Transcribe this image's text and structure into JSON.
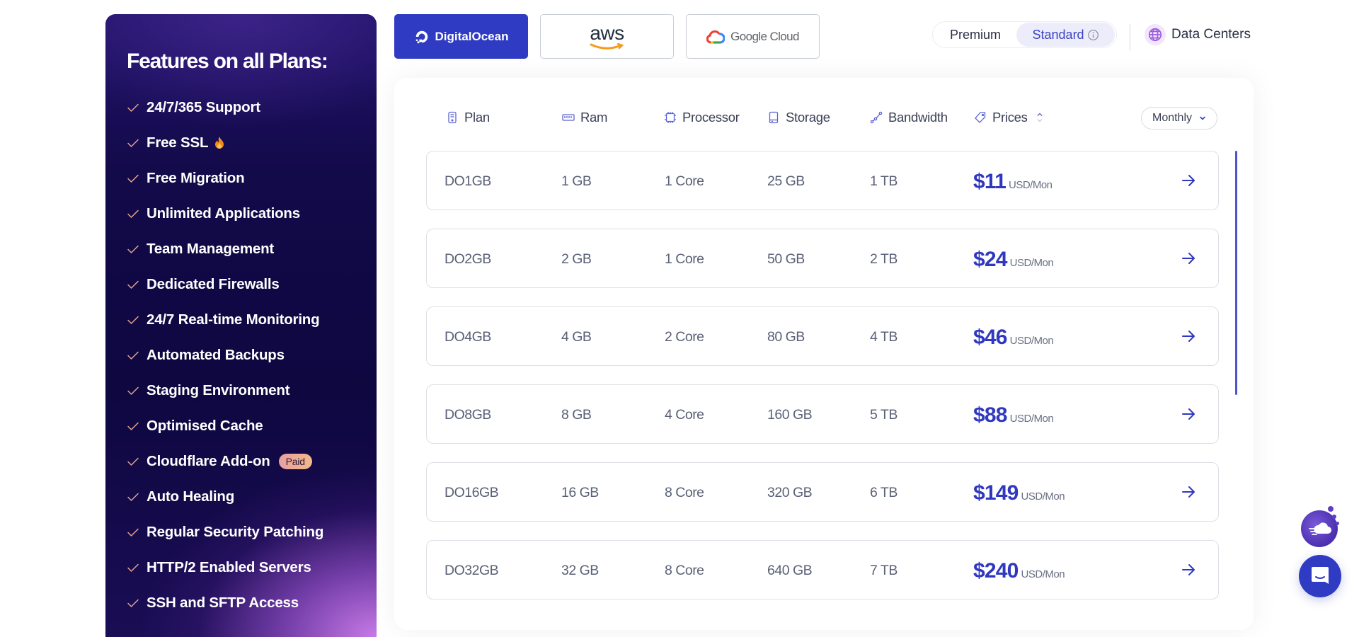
{
  "sidebar": {
    "title": "Features on all Plans:",
    "features": [
      {
        "label": "24/7/365 Support"
      },
      {
        "label": "Free SSL",
        "icon": "fire-icon"
      },
      {
        "label": "Free Migration"
      },
      {
        "label": "Unlimited Applications"
      },
      {
        "label": "Team Management"
      },
      {
        "label": "Dedicated Firewalls"
      },
      {
        "label": "24/7 Real-time Monitoring"
      },
      {
        "label": "Automated Backups"
      },
      {
        "label": "Staging Environment"
      },
      {
        "label": "Optimised Cache"
      },
      {
        "label": "Cloudflare Add-on",
        "badge": "Paid"
      },
      {
        "label": "Auto Healing"
      },
      {
        "label": "Regular Security Patching"
      },
      {
        "label": "HTTP/2 Enabled Servers"
      },
      {
        "label": "SSH and SFTP Access"
      }
    ]
  },
  "providers": [
    {
      "label": "DigitalOcean",
      "icon": "digitalocean-logo-icon",
      "active": true
    },
    {
      "label": "aws",
      "icon": "aws-logo-icon",
      "active": false
    },
    {
      "label": "Google Cloud",
      "icon": "google-cloud-logo-icon",
      "active": false
    }
  ],
  "tier_toggle": {
    "options": [
      "Premium",
      "Standard"
    ],
    "selected": "Standard"
  },
  "data_centers": {
    "label": "Data Centers",
    "icon": "globe-icon"
  },
  "table": {
    "columns": [
      {
        "label": "Plan",
        "icon": "server-icon"
      },
      {
        "label": "Ram",
        "icon": "ram-icon"
      },
      {
        "label": "Processor",
        "icon": "cpu-icon"
      },
      {
        "label": "Storage",
        "icon": "storage-icon"
      },
      {
        "label": "Bandwidth",
        "icon": "bandwidth-icon"
      },
      {
        "label": "Prices",
        "icon": "tag-icon"
      }
    ],
    "billing_period": "Monthly",
    "rows": [
      {
        "plan": "DO1GB",
        "ram": "1 GB",
        "processor": "1 Core",
        "storage": "25 GB",
        "bandwidth": "1 TB",
        "price": "$11",
        "unit": "USD/Mon"
      },
      {
        "plan": "DO2GB",
        "ram": "2 GB",
        "processor": "1 Core",
        "storage": "50 GB",
        "bandwidth": "2 TB",
        "price": "$24",
        "unit": "USD/Mon"
      },
      {
        "plan": "DO4GB",
        "ram": "4 GB",
        "processor": "2 Core",
        "storage": "80 GB",
        "bandwidth": "4 TB",
        "price": "$46",
        "unit": "USD/Mon"
      },
      {
        "plan": "DO8GB",
        "ram": "8 GB",
        "processor": "4 Core",
        "storage": "160 GB",
        "bandwidth": "5 TB",
        "price": "$88",
        "unit": "USD/Mon"
      },
      {
        "plan": "DO16GB",
        "ram": "16 GB",
        "processor": "8 Core",
        "storage": "320 GB",
        "bandwidth": "6 TB",
        "price": "$149",
        "unit": "USD/Mon"
      },
      {
        "plan": "DO32GB",
        "ram": "32 GB",
        "processor": "8 Core",
        "storage": "640 GB",
        "bandwidth": "7 TB",
        "price": "$240",
        "unit": "USD/Mon"
      }
    ]
  },
  "colors": {
    "accent": "#2f3bc2",
    "price": "#2f38bf",
    "sidebar_dark": "#0e0740",
    "sidebar_glow": "#c77ae6"
  }
}
